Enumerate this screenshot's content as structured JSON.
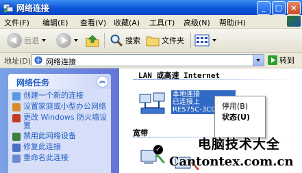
{
  "window": {
    "title": "网络连接",
    "controls": {
      "minimize": "_",
      "maximize": "□",
      "close": "×"
    }
  },
  "menubar": {
    "items": [
      "文件(F)",
      "编辑(E)",
      "查看(V)",
      "收藏(A)",
      "工具(T)",
      "高级(N)",
      "帮助(H)"
    ]
  },
  "toolbar": {
    "back_label": "后退",
    "search_label": "搜索",
    "folders_label": "文件夹"
  },
  "address": {
    "label": "地址(D)",
    "value": "网络连接",
    "go_label": "转到"
  },
  "taskpane": {
    "title": "网络任务",
    "tasks": [
      "创建一个新的连接",
      "设置家庭或小型办公网络",
      "更改 Windows 防火墙设置",
      "禁用此网络设备",
      "修复此连接",
      "重命名此连接"
    ]
  },
  "content": {
    "lan_group": "LAN 或高速 Internet",
    "lan_connection": {
      "name": "本地连接",
      "status": "已连接上",
      "device": "RE575C-3C0"
    },
    "broadband_group": "宽带"
  },
  "context_menu": {
    "items": [
      "停用(B)",
      "状态(U)"
    ]
  },
  "watermark": {
    "title": "电脑技术大全",
    "url": "Cantontex.com.cn"
  },
  "colors": {
    "titlebar": "#0a55d8",
    "taskpane": "#6375d6",
    "selection": "#316ac5"
  }
}
